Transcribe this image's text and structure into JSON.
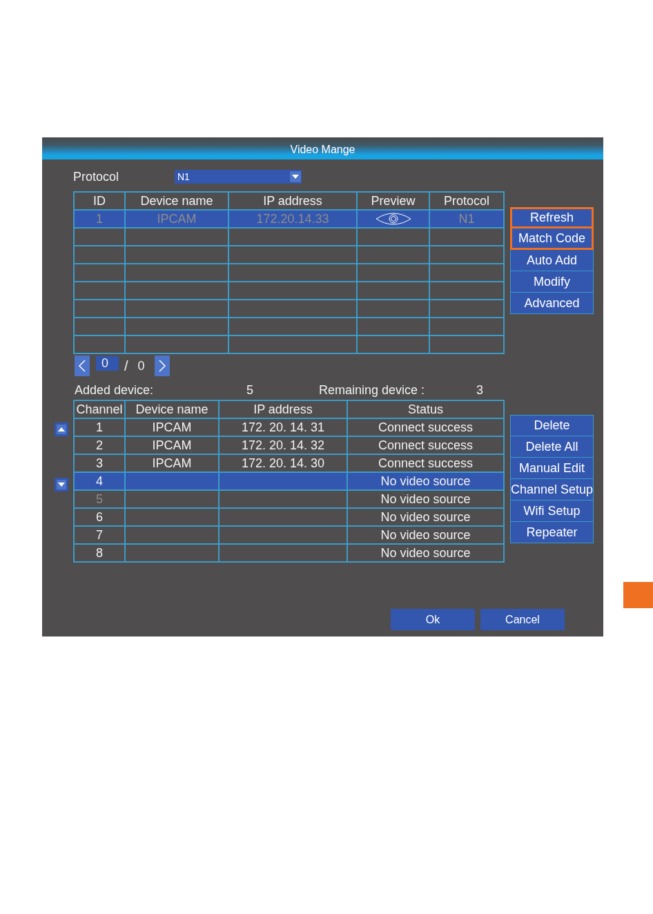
{
  "window": {
    "title": "Video Mange"
  },
  "protocol": {
    "label": "Protocol",
    "value": "N1"
  },
  "device_table": {
    "columns": [
      "ID",
      "Device name",
      "IP address",
      "Preview",
      "Protocol"
    ],
    "rows": [
      {
        "id": "1",
        "device_name": "IPCAM",
        "ip_address": "172.20.14.33",
        "preview": true,
        "protocol": "N1",
        "selected": true,
        "disabled": true
      }
    ]
  },
  "device_actions": [
    {
      "label": "Refresh",
      "highlighted": true
    },
    {
      "label": "Match Code",
      "highlighted": true
    },
    {
      "label": "Auto Add",
      "highlighted": false
    },
    {
      "label": "Modify",
      "highlighted": false
    },
    {
      "label": "Advanced",
      "highlighted": false
    }
  ],
  "pager": {
    "current": "0",
    "separator": "/",
    "total": "0"
  },
  "summary": {
    "added_label": "Added device:",
    "added_value": "5",
    "remaining_label": "Remaining device :",
    "remaining_value": "3"
  },
  "channel_table": {
    "columns": [
      "Channel",
      "Device name",
      "IP address",
      "Status"
    ],
    "rows": [
      {
        "channel": "1",
        "device_name": "IPCAM",
        "ip_address": "172. 20. 14. 31",
        "status": "Connect success",
        "selected": false,
        "disabled": false
      },
      {
        "channel": "2",
        "device_name": "IPCAM",
        "ip_address": "172. 20. 14. 32",
        "status": "Connect success",
        "selected": false,
        "disabled": false
      },
      {
        "channel": "3",
        "device_name": "IPCAM",
        "ip_address": "172. 20. 14. 30",
        "status": "Connect success",
        "selected": false,
        "disabled": false
      },
      {
        "channel": "4",
        "status": "No video source",
        "selected": true,
        "disabled": false
      },
      {
        "channel": "5",
        "status": "No video source",
        "selected": false,
        "disabled": true
      },
      {
        "channel": "6",
        "status": "No video source",
        "selected": false,
        "disabled": false
      },
      {
        "channel": "7",
        "status": "No video source",
        "selected": false,
        "disabled": false
      },
      {
        "channel": "8",
        "status": "No video source",
        "selected": false,
        "disabled": false
      }
    ]
  },
  "channel_actions": [
    {
      "label": "Delete",
      "highlighted": false
    },
    {
      "label": "Delete All",
      "highlighted": false
    },
    {
      "label": "Manual Edit",
      "highlighted": false
    },
    {
      "label": "Channel Setup",
      "highlighted": false
    },
    {
      "label": "Wifi Setup",
      "highlighted": false
    },
    {
      "label": "Repeater",
      "highlighted": false
    }
  ],
  "footer_buttons": [
    "Ok",
    "Cancel"
  ]
}
